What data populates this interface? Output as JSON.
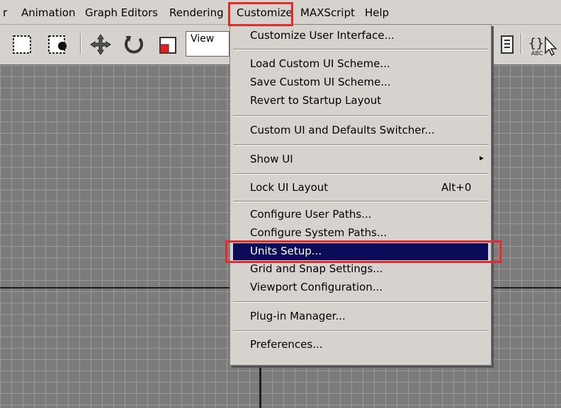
{
  "menubar": {
    "items": [
      "r",
      "Animation",
      "Graph Editors",
      "Rendering",
      "Customize",
      "MAXScript",
      "Help"
    ]
  },
  "toolbar": {
    "view_label": "View",
    "icons": [
      "select-region-icon",
      "select-object-icon",
      "move-icon",
      "rotate-icon",
      "scale-icon",
      "list-icon",
      "maxscript-icon"
    ]
  },
  "customize_menu": {
    "items": [
      {
        "label": "Customize User Interface..."
      },
      {
        "label": "Load Custom UI Scheme..."
      },
      {
        "label": "Save Custom UI Scheme..."
      },
      {
        "label": "Revert to Startup Layout"
      },
      {
        "label": "Custom UI and Defaults Switcher..."
      },
      {
        "label": "Show UI",
        "submenu": "▸"
      },
      {
        "label": "Lock UI Layout",
        "shortcut": "Alt+0"
      },
      {
        "label": "Configure User Paths..."
      },
      {
        "label": "Configure System Paths..."
      },
      {
        "label": "Units Setup..."
      },
      {
        "label": "Grid and Snap Settings..."
      },
      {
        "label": "Viewport Configuration..."
      },
      {
        "label": "Plug-in Manager..."
      },
      {
        "label": "Preferences..."
      }
    ],
    "highlighted": "Units Setup..."
  },
  "colors": {
    "highlight": "#0b0b5a",
    "callout": "#e42a2a",
    "menu_bg": "#d6d3ce"
  }
}
